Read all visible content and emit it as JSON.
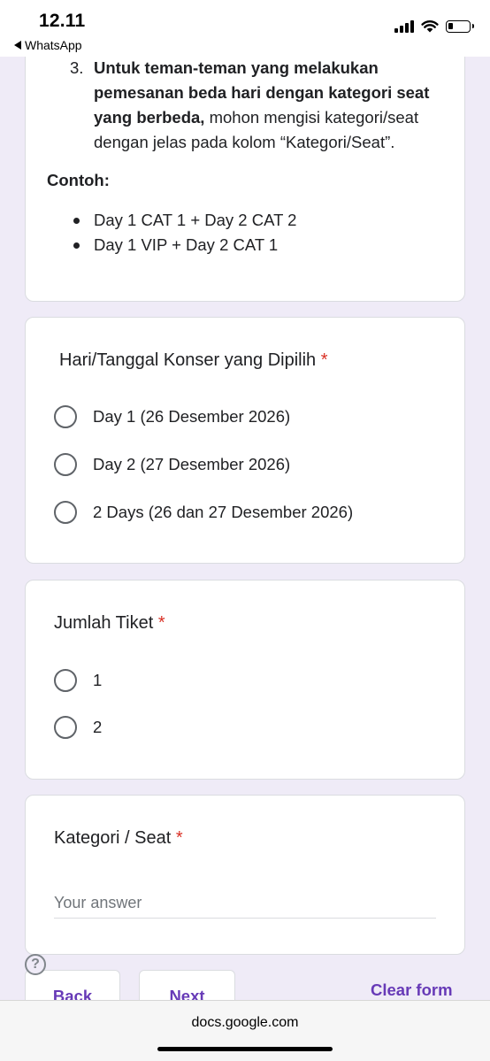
{
  "status_bar": {
    "time": "12.11",
    "back_app": "WhatsApp"
  },
  "intro": {
    "item_number": "3.",
    "bold_text": "Untuk teman-teman yang melakukan pemesanan beda hari dengan kategori seat yang berbeda,",
    "normal_text": " mohon mengisi kategori/seat dengan jelas pada kolom “Kategori/Seat”.",
    "example_heading": "Contoh:",
    "examples": [
      "Day 1 CAT 1 + Day 2 CAT 2",
      "Day 1 VIP + Day 2 CAT 1"
    ]
  },
  "questions": {
    "date": {
      "title": "Hari/Tanggal Konser yang Dipilih",
      "required_mark": "*",
      "options": [
        "Day 1 (26 Desember 2026)",
        "Day 2 (27 Desember 2026)",
        "2 Days (26 dan 27 Desember 2026)"
      ]
    },
    "quantity": {
      "title": "Jumlah Tiket",
      "required_mark": "*",
      "options": [
        "1",
        "2"
      ]
    },
    "category": {
      "title": "Kategori / Seat",
      "required_mark": "*",
      "placeholder": "Your answer",
      "value": ""
    }
  },
  "nav": {
    "help_symbol": "?",
    "back_label": "Back",
    "next_label": "Next",
    "clear_label": "Clear form"
  },
  "browser": {
    "url": "docs.google.com"
  },
  "colors": {
    "page_bg": "#efebf7",
    "accent": "#673ab7",
    "required": "#d93025"
  }
}
